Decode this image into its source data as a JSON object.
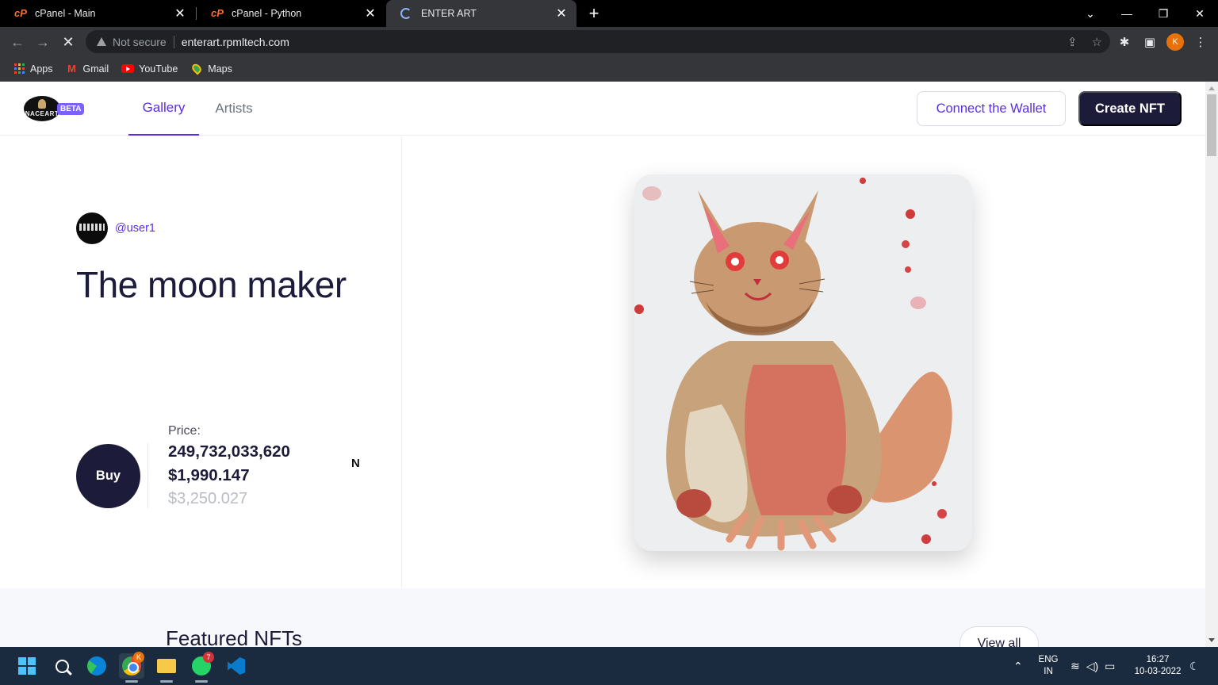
{
  "browser": {
    "tabs": [
      {
        "title": "cPanel - Main",
        "favicon": "cpanel-icon",
        "active": false
      },
      {
        "title": "cPanel - Python",
        "favicon": "cpanel-icon",
        "active": false
      },
      {
        "title": "ENTER ART",
        "favicon": "loading-spinner",
        "active": true
      }
    ],
    "favicon_text": "cP",
    "omnibox": {
      "security": "Not secure",
      "url": "enterart.rpmltech.com"
    },
    "profile_initial": "K",
    "bookmarks": [
      {
        "label": "Apps",
        "icon": "apps-grid-icon"
      },
      {
        "label": "Gmail",
        "icon": "gmail-icon"
      },
      {
        "label": "YouTube",
        "icon": "youtube-icon"
      },
      {
        "label": "Maps",
        "icon": "maps-icon"
      }
    ]
  },
  "site": {
    "logo_text": "NACEART",
    "beta_label": "BETA",
    "nav": [
      {
        "label": "Gallery",
        "active": true
      },
      {
        "label": "Artists",
        "active": false
      }
    ],
    "connect_wallet_label": "Connect the Wallet",
    "create_nft_label": "Create NFT",
    "accent_color": "#5b2ee6",
    "primary_dark": "#1d1b3a"
  },
  "hero": {
    "username": "@user1",
    "title": "The moon maker",
    "buy_label": "Buy",
    "price_label": "Price:",
    "price_token": "249,732,033,620",
    "price_usd": "$1,990.147",
    "price_old": "$3,250.027",
    "token_symbol": "N",
    "artwork": "watercolor cat painting"
  },
  "featured": {
    "title": "Featured NFTs",
    "view_all_label": "View all"
  },
  "taskbar": {
    "whatsapp_badge": "7",
    "chrome_badge": "K",
    "lang_primary": "ENG",
    "lang_secondary": "IN",
    "time": "16:27",
    "date": "10-03-2022"
  }
}
